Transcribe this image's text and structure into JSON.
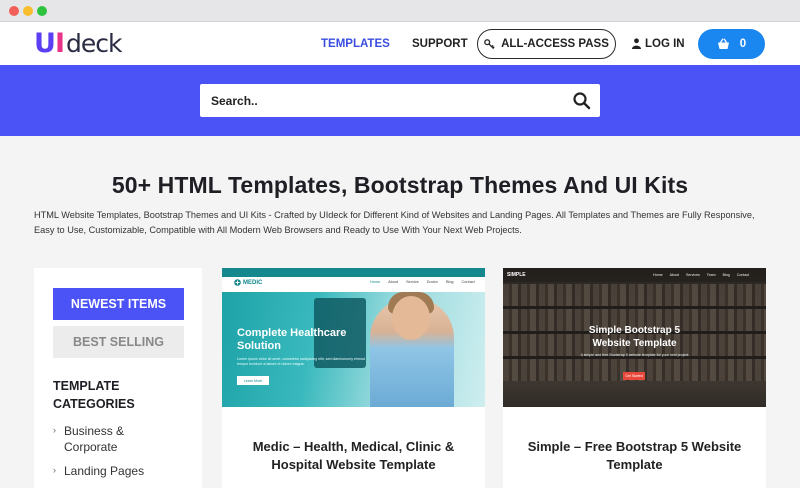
{
  "header": {
    "logo": {
      "part1": "U",
      "part2": "I",
      "part3": "deck"
    },
    "nav": {
      "templates": "TEMPLATES",
      "support": "SUPPORT"
    },
    "all_access_label": "ALL-ACCESS PASS",
    "login_label": "LOG IN",
    "cart_count": "0"
  },
  "search": {
    "placeholder": "Search.."
  },
  "page": {
    "title": "50+ HTML Templates, Bootstrap Themes And UI Kits",
    "description": "HTML Website Templates, Bootstrap Themes and UI Kits - Crafted by UIdeck for Different Kind of Websites and Landing Pages. All Templates and Themes are Fully Responsive, Easy to Use, Customizable, Compatible with All Modern Web Browsers and Ready to Use With Your Next Web Projects."
  },
  "sidebar": {
    "tabs": {
      "newest": "NEWEST ITEMS",
      "best": "BEST SELLING"
    },
    "categories_title": "TEMPLATE CATEGORIES",
    "categories": [
      "Business & Corporate",
      "Landing Pages"
    ]
  },
  "cards": [
    {
      "title": "Medic – Health, Medical, Clinic & Hospital Website Template",
      "thumb": {
        "brand": "MEDIC",
        "links": [
          "Home",
          "About",
          "Service",
          "Doctor",
          "Blog",
          "Contact"
        ],
        "heading": "Complete Healthcare Solution",
        "text": "Lorem ipsum dolor sit amet, consetetur sadipscing elitr, sed diamnonumy eirmod tempor invidunt ut labore et dolore magna.",
        "button": "Learn More"
      }
    },
    {
      "title": "Simple – Free Bootstrap 5 Website Template",
      "thumb": {
        "brand": "SIMPLE",
        "links": [
          "Home",
          "About",
          "Services",
          "Team",
          "Blog",
          "Contact"
        ],
        "heading": "Simple Bootstrap 5 Website Template",
        "text": "A simple and free Bootstrap 5 website template for your next project.",
        "button": "Get Started"
      }
    }
  ],
  "colors": {
    "accent": "#4b52f6",
    "nav_active": "#3a4de0",
    "cart": "#1a86f0",
    "medic": "#1ca1a6"
  }
}
